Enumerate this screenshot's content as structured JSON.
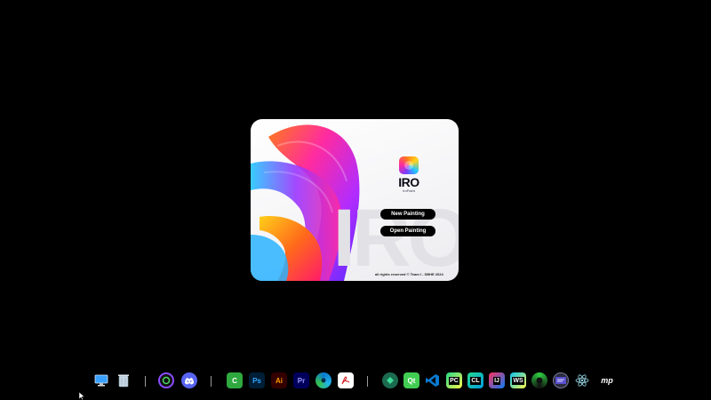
{
  "splash": {
    "app_name": "IRO",
    "app_subtitle": "IroPaint",
    "watermark": "IRO",
    "buttons": {
      "new_painting": "New Painting",
      "open_painting": "Open Painting"
    },
    "footer": "all rights reserved © Team I - SBHE 2024"
  },
  "taskbar": {
    "groups": [
      [
        "monitor-icon",
        "recycle-bin-icon"
      ],
      [
        "spiral-app-icon",
        "discord-icon"
      ],
      [
        "camtasia-icon",
        "photoshop-icon",
        "illustrator-icon",
        "premiere-pro-icon",
        "edge-icon",
        "acrobat-icon"
      ],
      [
        "git-icon",
        "qt-icon",
        "vscode-icon",
        "pycharm-icon",
        "clion-icon",
        "intellij-icon",
        "webstorm-icon",
        "ring-app-icon",
        "terminal-app-icon",
        "atom-icon",
        "mp-app-icon"
      ]
    ],
    "labels": {
      "photoshop": "Ps",
      "illustrator": "Ai",
      "premiere": "Pr",
      "qt": "Qt",
      "pycharm": "PC",
      "clion": "CL",
      "intellij": "IJ",
      "webstorm": "WS",
      "camtasia": "C",
      "mp": "mp"
    },
    "colors": {
      "photoshop_bg": "#001e36",
      "photoshop_fg": "#31a8ff",
      "illustrator_bg": "#330000",
      "illustrator_fg": "#ff9a00",
      "premiere_bg": "#00005b",
      "premiere_fg": "#9999ff",
      "camtasia": "#2fa83f",
      "discord": "#5865f2",
      "qt": "#41cd52",
      "vscode": "#0a7ad1",
      "git": "#1b6b4f"
    }
  }
}
